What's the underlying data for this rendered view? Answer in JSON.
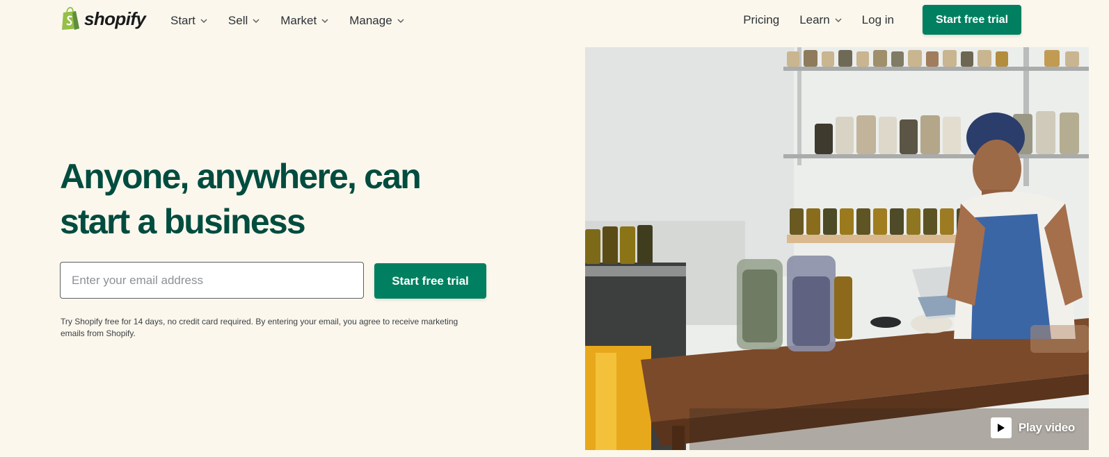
{
  "brand": {
    "name": "shopify",
    "accent": "#008060",
    "headline_color": "#004c3f"
  },
  "nav": {
    "left": [
      {
        "label": "Start"
      },
      {
        "label": "Sell"
      },
      {
        "label": "Market"
      },
      {
        "label": "Manage"
      }
    ],
    "right": {
      "pricing": "Pricing",
      "learn": "Learn",
      "login": "Log in",
      "cta": "Start free trial"
    }
  },
  "hero": {
    "title_line1": "Anyone, anywhere, can",
    "title_line2": "start a business",
    "email_placeholder": "Enter your email address",
    "email_value": "",
    "cta": "Start free trial",
    "disclaimer_line1": "Try Shopify free for 14 days, no credit card required. By entering your email, you agree to receive marketing",
    "disclaimer_line2": "emails from Shopify.",
    "play_label": "Play video"
  },
  "icons": {
    "logo": "shopify-bag-icon",
    "chevron": "chevron-down-icon",
    "play": "play-icon"
  }
}
